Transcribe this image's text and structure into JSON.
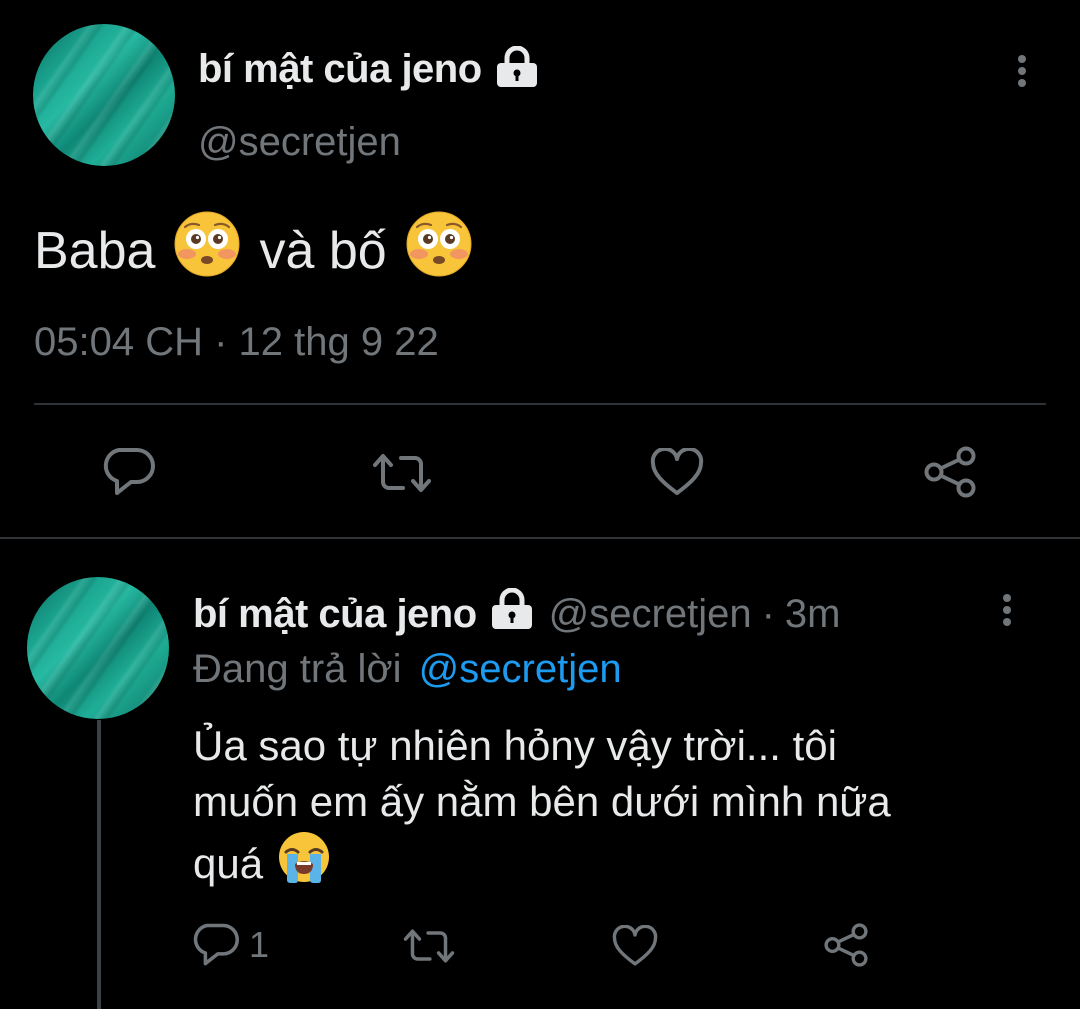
{
  "main_tweet": {
    "display_name": "bí mật của jeno",
    "handle": "@secretjen",
    "text_part1": "Baba",
    "text_part2": "và bố",
    "emoji_1": "flushed-face",
    "emoji_2": "flushed-face",
    "timestamp": "05:04 CH · 12 thg 9 22",
    "icons": {
      "lock": "lock-icon",
      "more": "more-vertical-icon",
      "reply": "reply-icon",
      "retweet": "retweet-icon",
      "like": "heart-icon",
      "share": "share-icon"
    }
  },
  "reply_tweet": {
    "display_name": "bí mật của jeno",
    "handle": "@secretjen",
    "time_ago": "3m",
    "separator": "·",
    "replying_label": "Đang trả lời",
    "replying_to": "@secretjen",
    "text_line1": "Ủa sao tự nhiên hỏny vậy trời... tôi",
    "text_line2": "muốn em ấy nằm bên dưới mình nữa",
    "text_line3": "quá",
    "emoji": "loudly-crying-face",
    "reply_count": "1"
  },
  "colors": {
    "background": "#000000",
    "text_primary": "#e7e9ea",
    "text_secondary": "#71767b",
    "accent": "#1d9bf0",
    "divider": "#2f3336",
    "avatar": "#1aa590"
  }
}
